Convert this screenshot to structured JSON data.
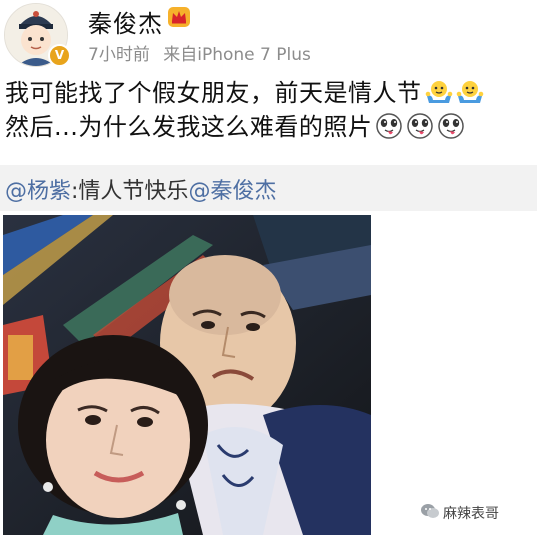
{
  "user": {
    "name": "秦俊杰",
    "verified_badge": "V",
    "time": "7小时前",
    "source_prefix": "来自",
    "device": "iPhone 7 Plus",
    "crown_icon": "vip-crown-icon"
  },
  "post": {
    "line1": "我可能找了个假女朋友，前天是情人节",
    "line2": "然后...为什么发我这么难看的照片",
    "emoji_line1": [
      "shrug-icon",
      "shrug-icon"
    ],
    "emoji_line2": [
      "tongue-face-icon",
      "tongue-face-icon",
      "tongue-face-icon"
    ]
  },
  "repost": {
    "mention1": "@杨紫",
    "text": ":情人节快乐",
    "mention2": "@秦俊杰"
  },
  "photo": {
    "description_icon": "selfie-photo"
  },
  "watermark": {
    "text": "麻辣表哥"
  },
  "colors": {
    "mention": "#4e6fa3",
    "meta": "#8c8c8c",
    "badge": "#e8a41c",
    "repost_bg": "#f2f2f2"
  }
}
